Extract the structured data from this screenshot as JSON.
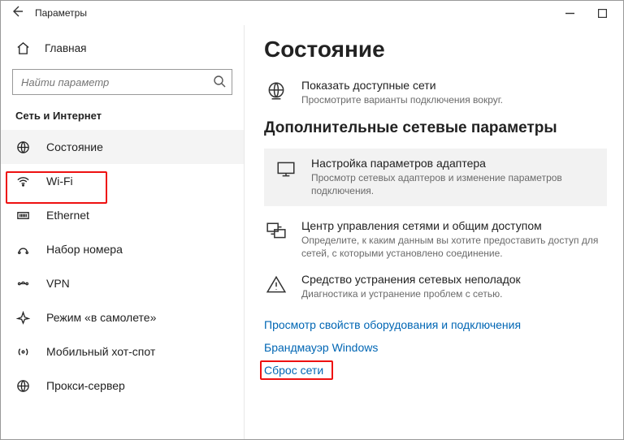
{
  "window": {
    "title": "Параметры"
  },
  "sidebar": {
    "home": "Главная",
    "searchPlaceholder": "Найти параметр",
    "section": "Сеть и Интернет",
    "items": [
      {
        "label": "Состояние"
      },
      {
        "label": "Wi-Fi"
      },
      {
        "label": "Ethernet"
      },
      {
        "label": "Набор номера"
      },
      {
        "label": "VPN"
      },
      {
        "label": "Режим «в самолете»"
      },
      {
        "label": "Мобильный хот-спот"
      },
      {
        "label": "Прокси-сервер"
      }
    ]
  },
  "content": {
    "title": "Состояние",
    "avail": {
      "title": "Показать доступные сети",
      "desc": "Просмотрите варианты подключения вокруг."
    },
    "advHeader": "Дополнительные сетевые параметры",
    "adapter": {
      "title": "Настройка параметров адаптера",
      "desc": "Просмотр сетевых адаптеров и изменение параметров подключения."
    },
    "sharing": {
      "title": "Центр управления сетями и общим доступом",
      "desc": "Определите, к каким данным вы хотите предоставить доступ для сетей, с которыми установлено соединение."
    },
    "trouble": {
      "title": "Средство устранения сетевых неполадок",
      "desc": "Диагностика и устранение проблем с сетью."
    },
    "links": {
      "props": "Просмотр свойств оборудования и подключения",
      "firewall": "Брандмауэр Windows",
      "reset": "Сброс сети"
    }
  }
}
